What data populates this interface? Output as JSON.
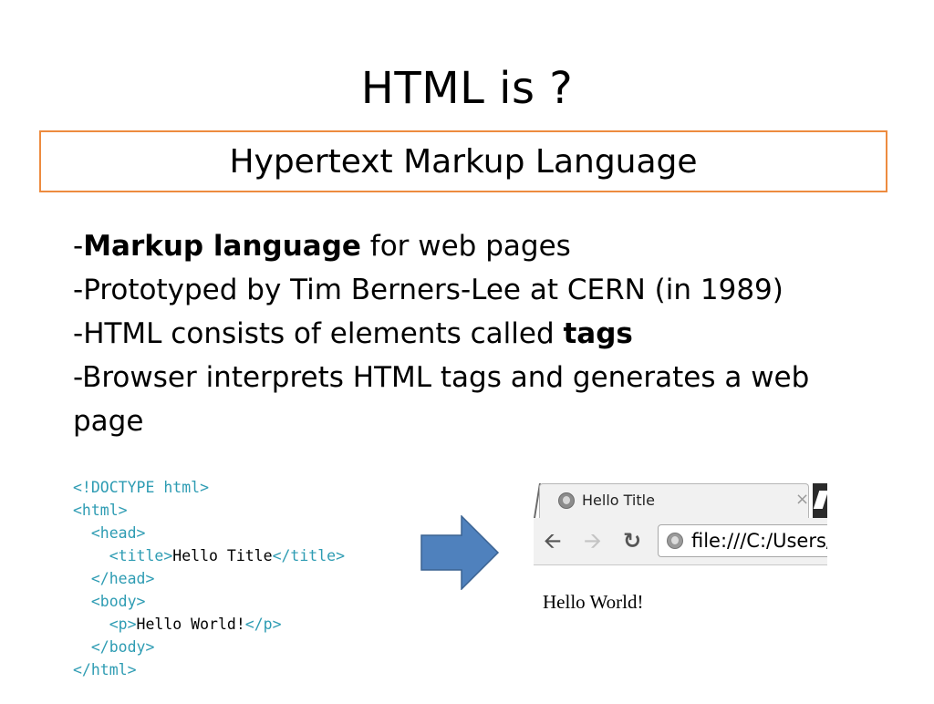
{
  "slide": {
    "title": "HTML is ?",
    "subtitle": "Hypertext Markup Language",
    "bullets": [
      {
        "prefix": "-",
        "bold": "Markup language",
        "text": " for web pages"
      },
      {
        "prefix": "-",
        "text": "Prototyped by Tim Berners-Lee at CERN (in 1989)"
      },
      {
        "prefix": "-",
        "text": "HTML consists of elements called ",
        "bold": "tags"
      },
      {
        "prefix": "-",
        "text": "Browser interprets HTML tags and generates a web page"
      }
    ],
    "accent_color": "#ed8b3f",
    "arrow_color": "#4f81bd"
  },
  "code": {
    "lines": [
      [
        "<!DOCTYPE html>"
      ],
      [
        "<html>"
      ],
      [
        "  <head>"
      ],
      [
        "    <title>",
        "Hello Title",
        "</title>"
      ],
      [
        "  </head>"
      ],
      [
        "  <body>"
      ],
      [
        "    <p>",
        "Hello World!",
        "</p>"
      ],
      [
        "  </body>"
      ],
      [
        "</html>"
      ]
    ],
    "tag_color": "#2e9cb3"
  },
  "browser": {
    "tab_title": "Hello Title",
    "tab_close": "×",
    "address": "file:///C:/Users/",
    "back_icon": "back-arrow-icon",
    "forward_icon": "forward-arrow-icon",
    "reload_icon": "reload-icon",
    "page_text": "Hello World!"
  }
}
